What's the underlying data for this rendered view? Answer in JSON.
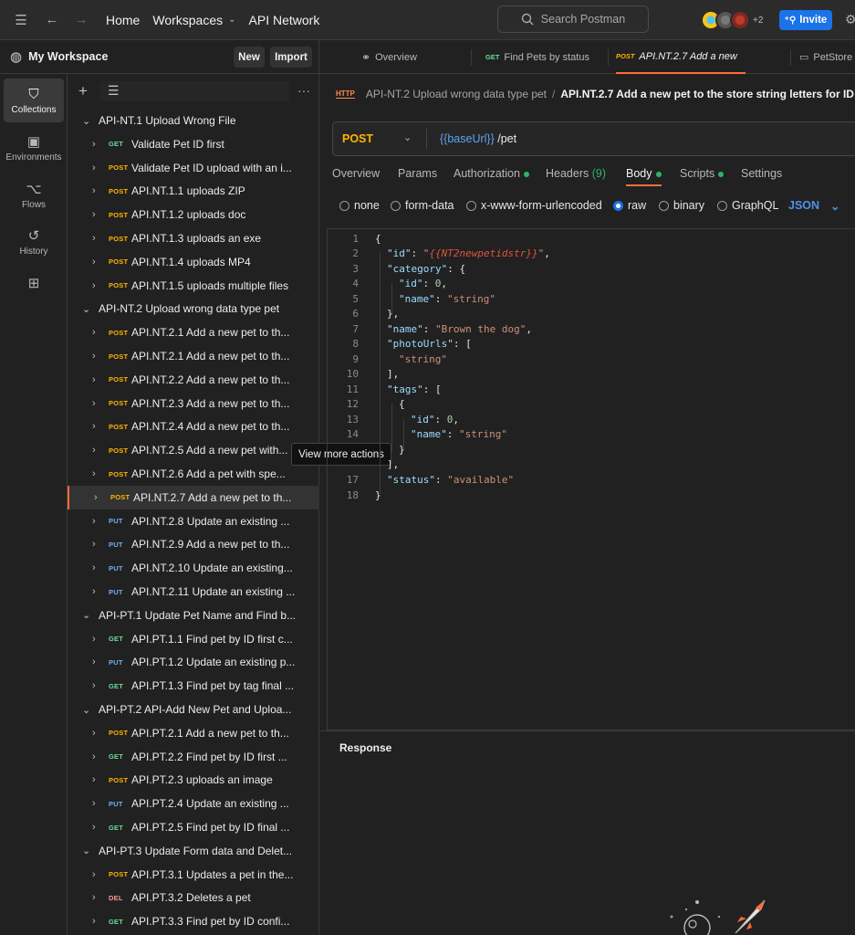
{
  "topbar": {
    "home": "Home",
    "workspaces": "Workspaces",
    "api_network": "API Network",
    "search_placeholder": "Search Postman",
    "avatar_count": "+2",
    "invite": "Invite"
  },
  "workspace": {
    "title": "My Workspace",
    "new": "New",
    "import": "Import"
  },
  "rail": [
    {
      "label": "Collections",
      "icon": "collections-icon"
    },
    {
      "label": "Environments",
      "icon": "environments-icon"
    },
    {
      "label": "Flows",
      "icon": "flows-icon"
    },
    {
      "label": "History",
      "icon": "history-icon"
    }
  ],
  "tabs": [
    {
      "label": "Overview",
      "method": ""
    },
    {
      "label": "Find Pets by status",
      "method": "GET"
    },
    {
      "label": "API.NT.2.7 Add a new p",
      "method": "POST"
    },
    {
      "label": "PetStore",
      "method": ""
    }
  ],
  "breadcrumb": {
    "icon": "HTTP",
    "parent": "API-NT.2 Upload wrong data type pet",
    "separator": "/",
    "current": "API.NT.2.7 Add a new pet to the store string letters for ID"
  },
  "request": {
    "method": "POST",
    "url_var": "{{baseUrl}}",
    "url_path": " /pet"
  },
  "subtabs": {
    "overview": "Overview",
    "params": "Params",
    "authorization": "Authorization",
    "headers": "Headers",
    "headers_count": "(9)",
    "body": "Body",
    "scripts": "Scripts",
    "settings": "Settings"
  },
  "body_types": {
    "none": "none",
    "form_data": "form-data",
    "urlencoded": "x-www-form-urlencoded",
    "raw": "raw",
    "binary": "binary",
    "graphql": "GraphQL",
    "format": "JSON",
    "selected": "raw"
  },
  "code": {
    "line_numbers": [
      "1",
      "2",
      "3",
      "4",
      "5",
      "6",
      "7",
      "8",
      "9",
      "10",
      "11",
      "12",
      "13",
      "14",
      "",
      "17",
      "18"
    ],
    "lines": [
      "{",
      "\"id\": \"{{NT2newpetidstr}}\",",
      "\"category\": {",
      "\"id\": 0,",
      "\"name\": \"string\"",
      "},",
      "\"name\": \"Brown the dog\",",
      "\"photoUrls\": [",
      "\"string\"",
      "],",
      "\"tags\": [",
      "{",
      "\"id\": 0,",
      "\"name\": \"string\"",
      "}",
      "],",
      "\"status\": \"available\"",
      "}"
    ]
  },
  "response": {
    "label": "Response"
  },
  "tooltip": "View more actions",
  "tree": [
    {
      "type": "folder",
      "label": "API-NT.1 Upload Wrong File"
    },
    {
      "type": "req",
      "method": "GET",
      "label": "Validate Pet ID first"
    },
    {
      "type": "req",
      "method": "POST",
      "label": "Validate Pet ID upload with an i..."
    },
    {
      "type": "req",
      "method": "POST",
      "label": "API.NT.1.1 uploads ZIP"
    },
    {
      "type": "req",
      "method": "POST",
      "label": "API.NT.1.2 uploads doc"
    },
    {
      "type": "req",
      "method": "POST",
      "label": "API.NT.1.3 uploads an exe"
    },
    {
      "type": "req",
      "method": "POST",
      "label": "API.NT.1.4 uploads MP4"
    },
    {
      "type": "req",
      "method": "POST",
      "label": "API.NT.1.5 uploads multiple files"
    },
    {
      "type": "folder",
      "label": "API-NT.2 Upload wrong data type pet"
    },
    {
      "type": "req",
      "method": "POST",
      "label": "API.NT.2.1 Add a new pet to th..."
    },
    {
      "type": "req",
      "method": "POST",
      "label": "API.NT.2.1 Add a new pet to th..."
    },
    {
      "type": "req",
      "method": "POST",
      "label": "API.NT.2.2 Add a new pet to th..."
    },
    {
      "type": "req",
      "method": "POST",
      "label": "API.NT.2.3 Add a new pet to th..."
    },
    {
      "type": "req",
      "method": "POST",
      "label": "API.NT.2.4 Add a new pet to th..."
    },
    {
      "type": "req",
      "method": "POST",
      "label": "API.NT.2.5 Add a new pet with..."
    },
    {
      "type": "req",
      "method": "POST",
      "label": "API.NT.2.6 Add a pet with spe..."
    },
    {
      "type": "req",
      "method": "POST",
      "label": "API.NT.2.7 Add a new pet to th...",
      "selected": true
    },
    {
      "type": "req",
      "method": "PUT",
      "label": "API.NT.2.8 Update an existing ..."
    },
    {
      "type": "req",
      "method": "PUT",
      "label": "API.NT.2.9 Add a new pet to th..."
    },
    {
      "type": "req",
      "method": "PUT",
      "label": "API.NT.2.10 Update an existing..."
    },
    {
      "type": "req",
      "method": "PUT",
      "label": "API.NT.2.11 Update an existing ..."
    },
    {
      "type": "folder",
      "label": "API-PT.1 Update Pet Name and Find b..."
    },
    {
      "type": "req",
      "method": "GET",
      "label": "API.PT.1.1 Find pet by ID first c..."
    },
    {
      "type": "req",
      "method": "PUT",
      "label": "API.PT.1.2 Update an existing p..."
    },
    {
      "type": "req",
      "method": "GET",
      "label": "API.PT.1.3 Find pet by tag final ..."
    },
    {
      "type": "folder",
      "label": "API-PT.2 API-Add New Pet and Uploa..."
    },
    {
      "type": "req",
      "method": "POST",
      "label": "API.PT.2.1 Add a new pet to th..."
    },
    {
      "type": "req",
      "method": "GET",
      "label": "API.PT.2.2 Find pet by ID first ..."
    },
    {
      "type": "req",
      "method": "POST",
      "label": "API.PT.2.3 uploads an image"
    },
    {
      "type": "req",
      "method": "PUT",
      "label": "API.PT.2.4 Update an existing ..."
    },
    {
      "type": "req",
      "method": "GET",
      "label": "API.PT.2.5 Find pet by ID final ..."
    },
    {
      "type": "folder",
      "label": "API-PT.3 Update Form data and Delet..."
    },
    {
      "type": "req",
      "method": "POST",
      "label": "API.PT.3.1 Updates a pet in the..."
    },
    {
      "type": "req",
      "method": "DEL",
      "label": "API.PT.3.2 Deletes a pet"
    },
    {
      "type": "req",
      "method": "GET",
      "label": "API.PT.3.3 Find pet by ID confi..."
    }
  ]
}
